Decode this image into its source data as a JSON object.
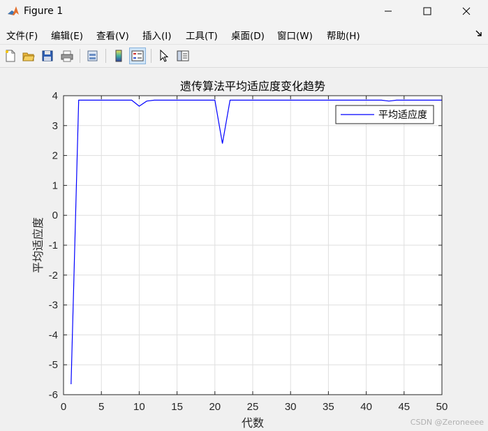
{
  "window": {
    "title": "Figure 1",
    "minimize_label": "—",
    "maximize_label": "☐",
    "close_label": "✕"
  },
  "menu": {
    "items": [
      {
        "name": "menu-file",
        "label": "文件(F)"
      },
      {
        "name": "menu-edit",
        "label": "编辑(E)"
      },
      {
        "name": "menu-view",
        "label": "查看(V)"
      },
      {
        "name": "menu-insert",
        "label": "插入(I)"
      },
      {
        "name": "menu-tools",
        "label": "工具(T)"
      },
      {
        "name": "menu-desktop",
        "label": "桌面(D)"
      },
      {
        "name": "menu-window",
        "label": "窗口(W)"
      },
      {
        "name": "menu-help",
        "label": "帮助(H)"
      }
    ],
    "overflow_icon": "arrow-icon"
  },
  "toolbar": {
    "buttons": [
      "new-figure-icon",
      "open-file-icon",
      "save-icon",
      "print-icon",
      "print-preview-icon",
      "colorbar-icon",
      "legend-icon",
      "pointer-icon",
      "property-editor-icon"
    ]
  },
  "chart_data": {
    "type": "line",
    "title": "遗传算法平均适应度变化趋势",
    "xlabel": "代数",
    "ylabel": "平均适应度",
    "xlim": [
      0,
      50
    ],
    "ylim": [
      -6,
      4
    ],
    "xticks": [
      "0",
      "5",
      "10",
      "15",
      "20",
      "25",
      "30",
      "35",
      "40",
      "45",
      "50"
    ],
    "yticks": [
      "-6",
      "-5",
      "-4",
      "-3",
      "-2",
      "-1",
      "0",
      "1",
      "2",
      "3",
      "4"
    ],
    "grid": true,
    "legend_position": "top-right",
    "series": [
      {
        "name": "平均适应度",
        "color": "#0000ff",
        "x": [
          1,
          2,
          3,
          4,
          5,
          6,
          7,
          8,
          9,
          10,
          11,
          12,
          13,
          14,
          15,
          16,
          17,
          18,
          19,
          20,
          21,
          22,
          23,
          24,
          25,
          26,
          27,
          28,
          29,
          30,
          31,
          32,
          33,
          34,
          35,
          36,
          37,
          38,
          39,
          40,
          41,
          42,
          43,
          44,
          45,
          46,
          47,
          48,
          49,
          50
        ],
        "y": [
          -5.65,
          3.85,
          3.85,
          3.85,
          3.85,
          3.85,
          3.85,
          3.85,
          3.85,
          3.65,
          3.82,
          3.85,
          3.85,
          3.85,
          3.85,
          3.85,
          3.85,
          3.85,
          3.85,
          3.85,
          2.4,
          3.85,
          3.85,
          3.85,
          3.85,
          3.85,
          3.85,
          3.85,
          3.85,
          3.85,
          3.85,
          3.85,
          3.85,
          3.85,
          3.85,
          3.85,
          3.85,
          3.85,
          3.85,
          3.85,
          3.85,
          3.85,
          3.82,
          3.85,
          3.85,
          3.85,
          3.85,
          3.85,
          3.85,
          3.85
        ]
      }
    ]
  },
  "watermark": "CSDN @Zeroneeee"
}
